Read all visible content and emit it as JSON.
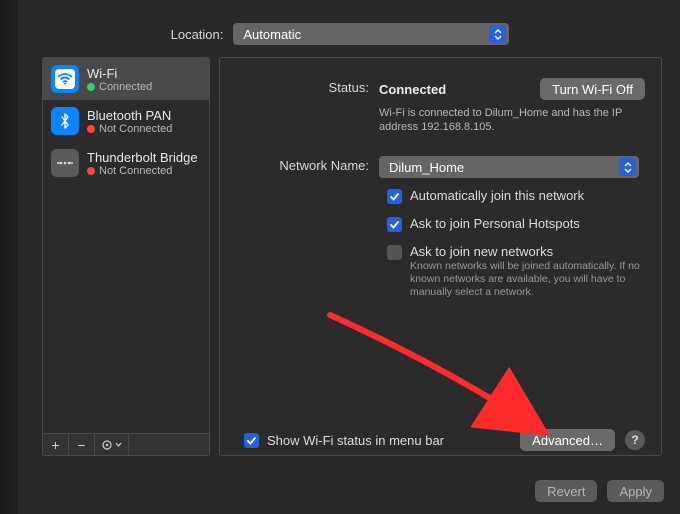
{
  "location": {
    "label": "Location:",
    "value": "Automatic"
  },
  "sidebar": {
    "items": [
      {
        "name": "Wi-Fi",
        "status": "Connected",
        "dot": "green",
        "selected": true,
        "icon": "wifi"
      },
      {
        "name": "Bluetooth PAN",
        "status": "Not Connected",
        "dot": "red",
        "selected": false,
        "icon": "bt"
      },
      {
        "name": "Thunderbolt Bridge",
        "status": "Not Connected",
        "dot": "red",
        "selected": false,
        "icon": "tb"
      }
    ],
    "buttons": {
      "add": "+",
      "remove": "−",
      "more": "⊙"
    }
  },
  "main": {
    "status_label": "Status:",
    "status_value": "Connected",
    "toggle_button": "Turn Wi-Fi Off",
    "status_desc": "Wi-Fi is connected to Dilum_Home and has the IP address 192.168.8.105.",
    "network_label": "Network Name:",
    "network_value": "Dilum_Home",
    "auto_join": "Automatically join this network",
    "ask_hotspot": "Ask to join Personal Hotspots",
    "ask_new": "Ask to join new networks",
    "ask_new_note": "Known networks will be joined automatically. If no known networks are available, you will have to manually select a network.",
    "show_status": "Show Wi-Fi status in menu bar",
    "advanced": "Advanced…",
    "help": "?"
  },
  "actions": {
    "revert": "Revert",
    "apply": "Apply"
  }
}
